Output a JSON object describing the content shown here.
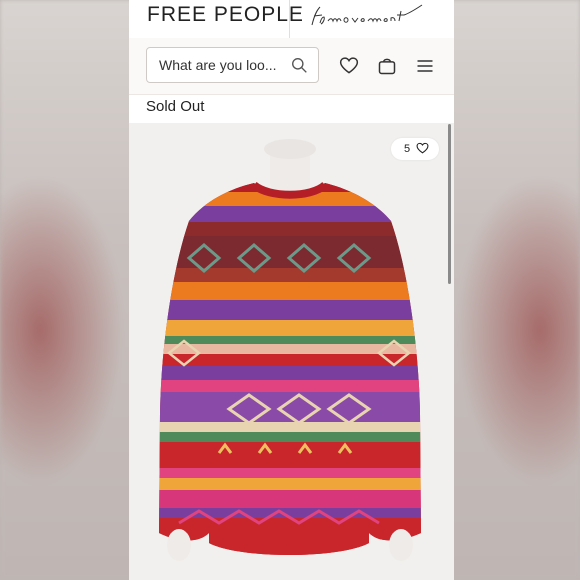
{
  "header": {
    "brand": "FREE PEOPLE",
    "sub_brand": "fp movement"
  },
  "search": {
    "placeholder": "What are you loo..."
  },
  "icons": [
    "search-icon",
    "heart-icon",
    "bag-icon",
    "menu-icon"
  ],
  "product": {
    "status": "Sold Out",
    "likes": "5"
  },
  "colors": {
    "sweater_red": "#c9262c",
    "sweater_orange": "#ec7a1f",
    "sweater_purple": "#7a3f9e",
    "sweater_pink": "#e0437f"
  }
}
